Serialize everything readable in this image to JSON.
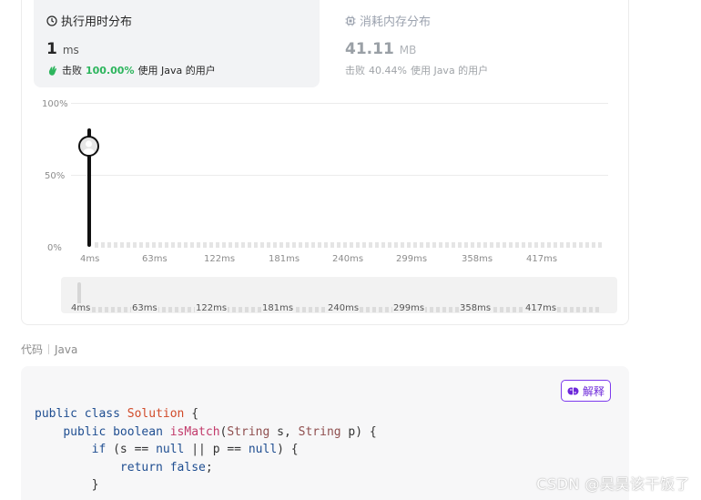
{
  "runtime": {
    "title": "执行用时分布",
    "value": "1",
    "unit": "ms",
    "beat_label": "击败",
    "beat_percent": "100.00%",
    "beat_suffix": "使用 Java 的用户"
  },
  "memory": {
    "title": "消耗内存分布",
    "value": "41.11",
    "unit": "MB",
    "beat_label": "击败",
    "beat_percent": "40.44%",
    "beat_suffix": "使用 Java 的用户"
  },
  "chart_data": {
    "type": "bar",
    "yticks": [
      "100%",
      "50%",
      "0%"
    ],
    "xticks": [
      "4ms",
      "63ms",
      "122ms",
      "181ms",
      "240ms",
      "299ms",
      "358ms",
      "417ms"
    ],
    "highlight": {
      "x": "1ms",
      "y": 80
    },
    "range_ticks": [
      "4ms",
      "63ms",
      "122ms",
      "181ms",
      "240ms",
      "299ms",
      "358ms",
      "417ms"
    ]
  },
  "code_section": {
    "label": "代码",
    "language": "Java",
    "explain_label": "解释"
  },
  "watermark": "CSDN @昊昊该干饭了",
  "colors": {
    "accent_green": "#2db55d",
    "explain_purple": "#7c3aed"
  }
}
